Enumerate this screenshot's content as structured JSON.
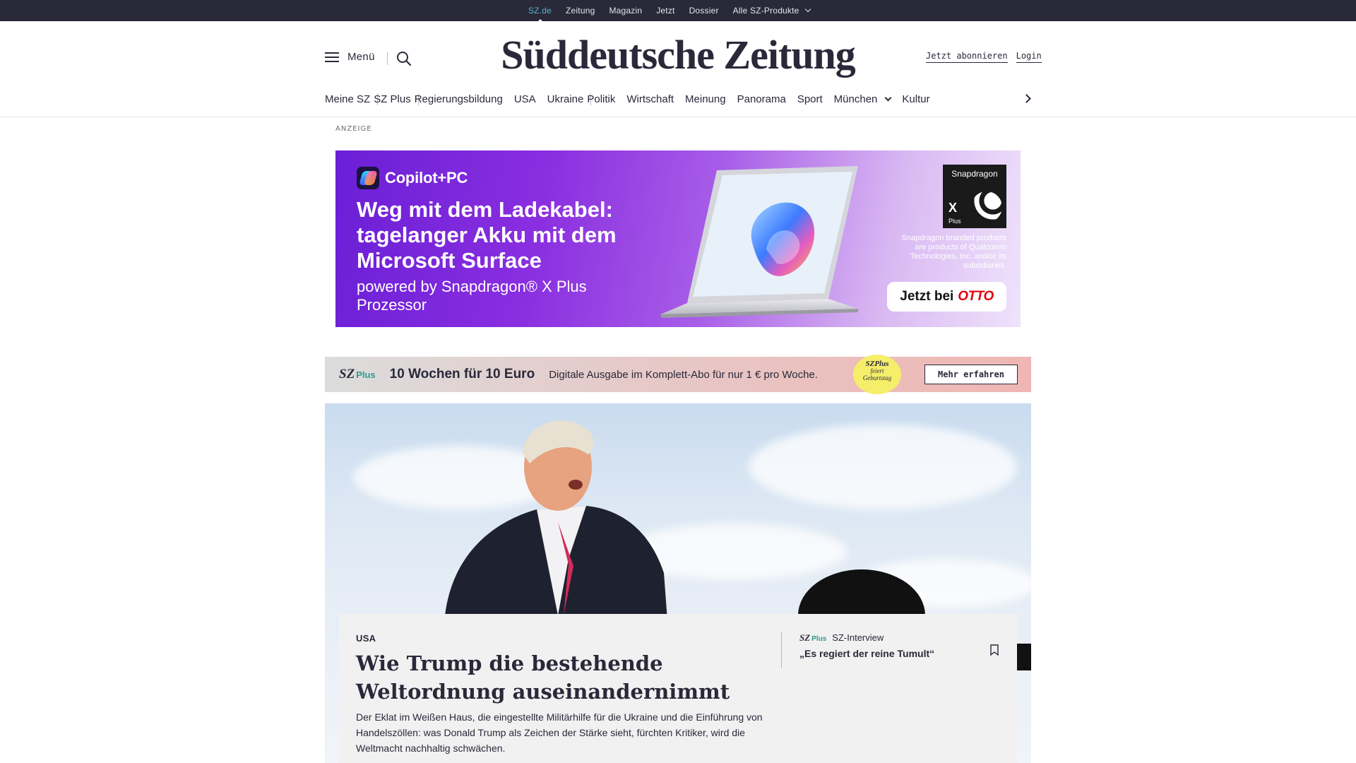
{
  "topbar": {
    "items": [
      {
        "label": "SZ.de",
        "active": true
      },
      {
        "label": "Zeitung"
      },
      {
        "label": "Magazin"
      },
      {
        "label": "Jetzt"
      },
      {
        "label": "Dossier"
      },
      {
        "label": "Alle SZ-Produkte",
        "dropdown": true
      }
    ]
  },
  "header": {
    "menu_label": "Menü",
    "logo": "Süddeutsche Zeitung",
    "subscribe_label": "Jetzt abonnieren",
    "login_label": "Login"
  },
  "nav": {
    "items": [
      "Meine SZ",
      "SZ Plus",
      "Regierungsbildung",
      "USA",
      "Ukraine",
      "Politik",
      "Wirtschaft",
      "Meinung",
      "Panorama",
      "Sport",
      "München",
      "Kultur"
    ]
  },
  "ad": {
    "label": "ANZEIGE",
    "brand": "Copilot+PC",
    "headline": "Weg mit dem Ladekabel: tagelanger Akku mit dem Microsoft Surface",
    "sub": "powered by Snapdragon® X Plus Prozessor",
    "snap_name": "Snapdragon",
    "snap_x": "X",
    "snap_plus": "Plus",
    "disclaimer": "Snapdragon branded products are products of Qualcomm Technologies, Inc. and/or its subsidiaries.",
    "cta_prefix": "Jetzt bei",
    "cta_brand": "OTTO",
    "colors": {
      "gradient_start": "#6a1fd6",
      "gradient_end": "#efe3fb"
    }
  },
  "promo": {
    "logo_sz": "SZ",
    "logo_plus": "Plus",
    "title": "10 Wochen für 10 Euro",
    "description": "Digitale Ausgabe im Komplett-Abo für nur 1 € pro Woche.",
    "badge_line1": "SZPlus",
    "badge_line2": "feiert",
    "badge_line3": "Geburtstag",
    "cta": "Mehr erfahren"
  },
  "hero": {
    "kicker": "USA",
    "title": "Wie Trump die bestehende Weltordnung auseinandernimmt",
    "text": "Der Eklat im Weißen Haus, die eingestellte Militärhilfe für die Ukraine und die Einführung von Handelszöllen: was Donald Trump als Zeichen der Stärke sieht, fürchten Kritiker, wird die Weltmacht nachhaltig schwächen.",
    "related": {
      "logo_sz": "SZ",
      "logo_plus": "Plus",
      "label": "SZ-Interview",
      "title": "„Es regiert der reine Tumult“"
    }
  },
  "colors": {
    "topbar": "#29293a",
    "accent_active": "#56b4c9",
    "sz_plus": "#2a9d8f"
  }
}
